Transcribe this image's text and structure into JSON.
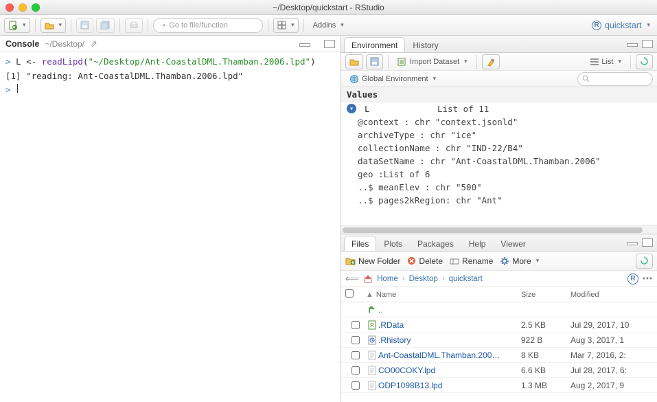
{
  "window_title": "~/Desktop/quickstart - RStudio",
  "project_name": "quickstart",
  "toolbar": {
    "goto_placeholder": "Go to file/function",
    "addins_label": "Addins"
  },
  "console": {
    "tab_label": "Console",
    "path": "~/Desktop/",
    "input_line_prefix": "L <- ",
    "input_func": "readLipd",
    "input_arg": "\"~/Desktop/Ant-CoastalDML.Thamban.2006.lpd\"",
    "output_line": "[1] \"reading: Ant-CoastalDML.Thamban.2006.lpd\""
  },
  "env": {
    "tabs": [
      "Environment",
      "History"
    ],
    "import_label": "Import Dataset",
    "scope_label": "Global Environment",
    "view_mode": "List",
    "section": "Values",
    "var_name": "L",
    "var_summary": "List of 11",
    "rows": [
      "@context : chr \"context.jsonld\"",
      "archiveType : chr \"ice\"",
      "collectionName : chr \"IND-22/B4\"",
      "dataSetName : chr \"Ant-CoastalDML.Thamban.2006\"",
      "geo :List of 6",
      "..$ meanElev : chr \"500\"",
      "..$ pages2kRegion: chr \"Ant\""
    ]
  },
  "files": {
    "tabs": [
      "Files",
      "Plots",
      "Packages",
      "Help",
      "Viewer"
    ],
    "actions": {
      "new_folder": "New Folder",
      "delete": "Delete",
      "rename": "Rename",
      "more": "More"
    },
    "crumbs": [
      "Home",
      "Desktop",
      "quickstart"
    ],
    "columns": {
      "name": "Name",
      "size": "Size",
      "modified": "Modified"
    },
    "parent_label": "..",
    "items": [
      {
        "icon": "rdata",
        "name": ".RData",
        "size": "2.5 KB",
        "modified": "Jul 29, 2017, 10"
      },
      {
        "icon": "text",
        "name": ".Rhistory",
        "size": "922 B",
        "modified": "Aug 3, 2017, 1"
      },
      {
        "icon": "file",
        "name": "Ant-CoastalDML.Thamban.200…",
        "size": "8 KB",
        "modified": "Mar 7, 2016, 2:"
      },
      {
        "icon": "file",
        "name": "CO00COKY.lpd",
        "size": "6.6 KB",
        "modified": "Jul 28, 2017, 6:"
      },
      {
        "icon": "file",
        "name": "ODP1098B13.lpd",
        "size": "1.3 MB",
        "modified": "Aug 2, 2017, 9"
      }
    ]
  }
}
